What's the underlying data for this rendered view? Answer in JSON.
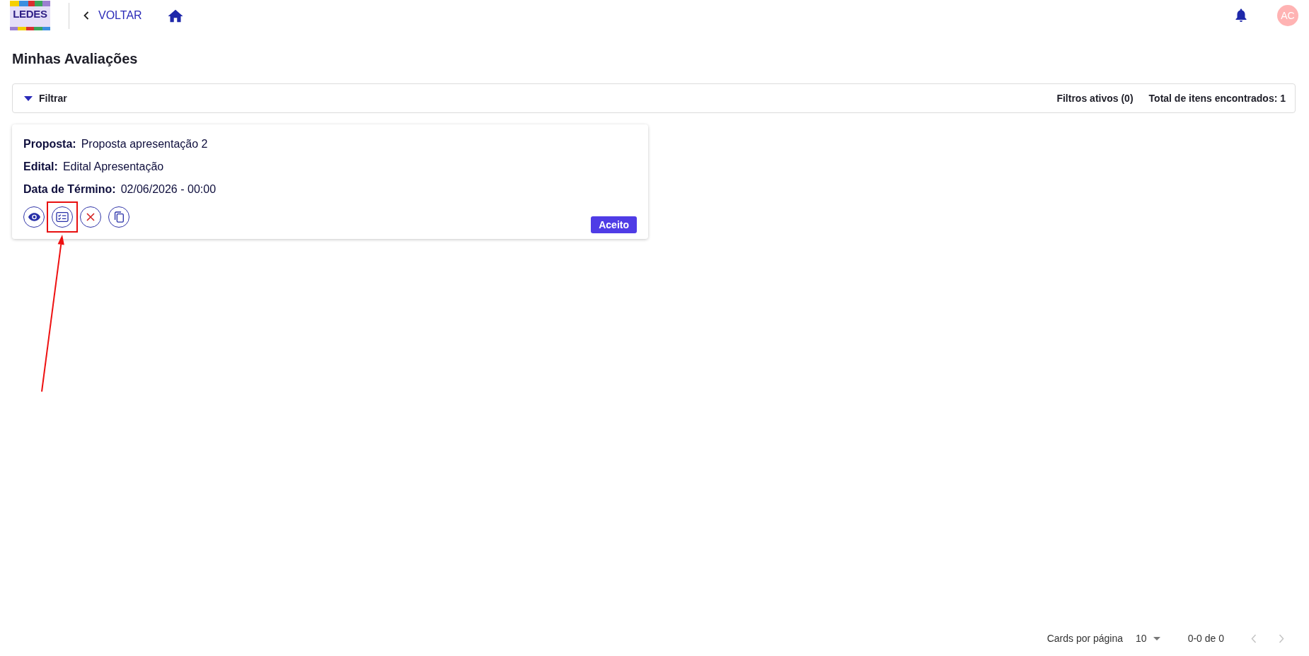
{
  "header": {
    "logo": {
      "text": "LEDES"
    },
    "back": {
      "label": "VOLTAR"
    },
    "user": {
      "initials": "AC"
    }
  },
  "page": {
    "title": "Minhas Avaliações"
  },
  "filter": {
    "label": "Filtrar",
    "active_filters": "Filtros ativos (0)",
    "total": "Total de itens encontrados: 1"
  },
  "cards": [
    {
      "fields": [
        {
          "label": "Proposta:",
          "value": "Proposta apresentação 2"
        },
        {
          "label": "Edital:",
          "value": "Edital Apresentação"
        },
        {
          "label": "Data de Término:",
          "value": "02/06/2026 - 00:00"
        }
      ],
      "actions": [
        {
          "kind": "view",
          "highlighted": false
        },
        {
          "kind": "form",
          "highlighted": true
        },
        {
          "kind": "cancel",
          "highlighted": false
        },
        {
          "kind": "copy",
          "highlighted": false
        }
      ],
      "status": "Aceito"
    }
  ],
  "pagination": {
    "label": "Cards por página",
    "per_page": "10",
    "range": "0-0 de 0",
    "prev": {
      "disabled": true
    },
    "next": {
      "disabled": true
    }
  }
}
